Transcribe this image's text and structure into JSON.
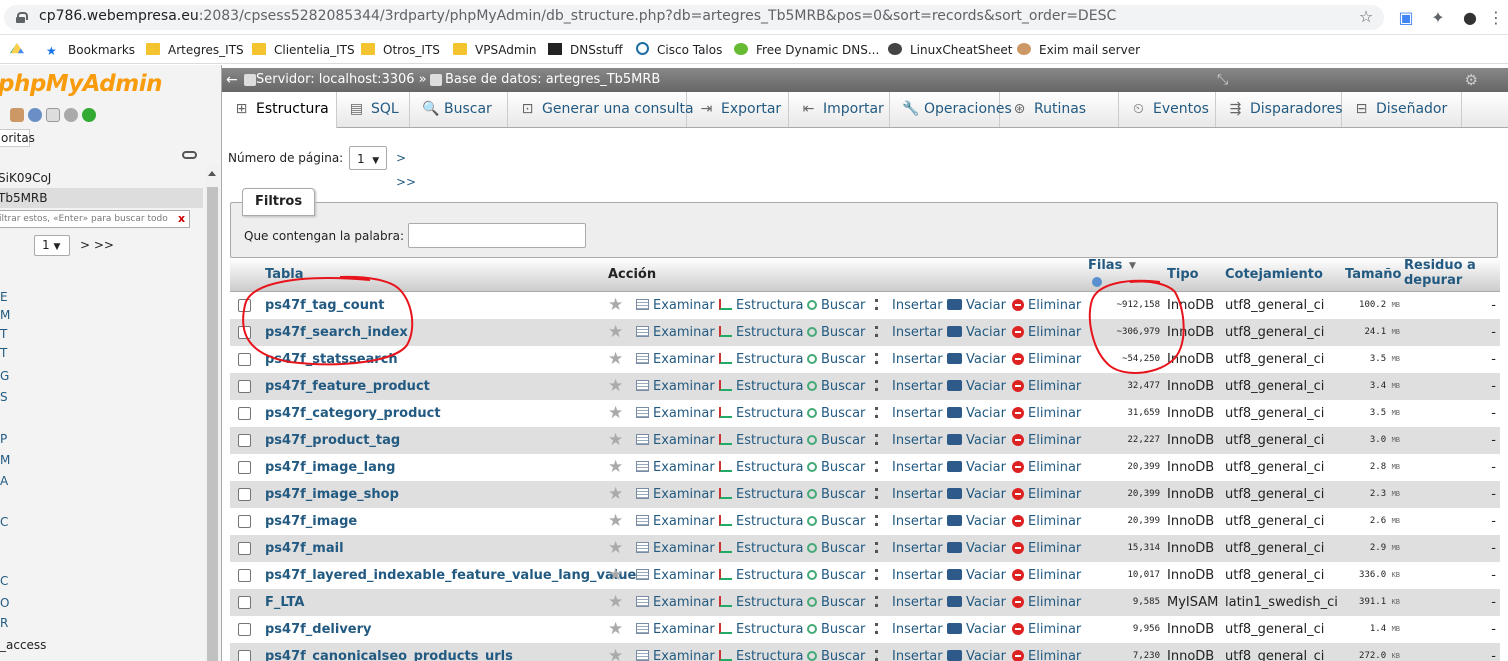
{
  "browser": {
    "url_host": "cp786.webempresa.eu",
    "url_rest": ":2083/cpsess5282085344/3rdparty/phpMyAdmin/db_structure.php?db=artegres_Tb5MRB&pos=0&sort=records&sort_order=DESC",
    "bookmarks": [
      "Bookmarks",
      "Artegres_ITS",
      "Clientelia_ITS",
      "Otros_ITS",
      "VPSAdmin",
      "DNSstuff",
      "Cisco Talos",
      "Free Dynamic DNS...",
      "LinuxCheatSheet",
      "Exim mail server"
    ]
  },
  "nav": {
    "logo_a": "p",
    "logo_b": "hpMyAdmin",
    "fav_tab": "oritas",
    "databases": [
      "SiK09CoJ",
      "Tb5MRB"
    ],
    "filter_placeholder": "iltrar estos, «Enter» para buscar todo",
    "page": "1",
    "next": "> >>",
    "table_letters": [
      "E",
      "M",
      "T",
      "T",
      "G",
      "S",
      "P",
      "M",
      "A",
      "C",
      "C",
      "O",
      "R",
      "_access"
    ]
  },
  "topbar": {
    "server": "Servidor: localhost:3306 »",
    "db": "Base de datos: artegres_Tb5MRB"
  },
  "tabs": [
    {
      "label": "Estructura",
      "icon": "structure-icon"
    },
    {
      "label": "SQL",
      "icon": "sql-icon"
    },
    {
      "label": "Buscar",
      "icon": "search-icon"
    },
    {
      "label": "Generar una consulta",
      "icon": "query-icon"
    },
    {
      "label": "Exportar",
      "icon": "export-icon"
    },
    {
      "label": "Importar",
      "icon": "import-icon"
    },
    {
      "label": "Operaciones",
      "icon": "wrench-icon"
    },
    {
      "label": "Rutinas",
      "icon": "routines-icon"
    },
    {
      "label": "Eventos",
      "icon": "clock-icon"
    },
    {
      "label": "Disparadores",
      "icon": "triggers-icon"
    },
    {
      "label": "Diseñador",
      "icon": "designer-icon"
    }
  ],
  "pagination": {
    "label": "Número de página:",
    "value": "1",
    "next": "> >>"
  },
  "filters": {
    "legend": "Filtros",
    "label": "Que contengan la palabra:",
    "value": ""
  },
  "table": {
    "headers": {
      "tabla": "Tabla",
      "accion": "Acción",
      "filas": "Filas",
      "tipo": "Tipo",
      "cotejamiento": "Cotejamiento",
      "tamano": "Tamaño",
      "residuo": "Residuo a depurar"
    },
    "actions": [
      "Examinar",
      "Estructura",
      "Buscar",
      "Insertar",
      "Vaciar",
      "Eliminar"
    ],
    "rows": [
      {
        "name": "ps47f_tag_count",
        "rows": "~912,158",
        "engine": "InnoDB",
        "collation": "utf8_general_ci",
        "size": "100.2",
        "unit": "MB",
        "overhead": "-"
      },
      {
        "name": "ps47f_search_index",
        "rows": "~306,979",
        "engine": "InnoDB",
        "collation": "utf8_general_ci",
        "size": "24.1",
        "unit": "MB",
        "overhead": "-"
      },
      {
        "name": "ps47f_statssearch",
        "rows": "~54,250",
        "engine": "InnoDB",
        "collation": "utf8_general_ci",
        "size": "3.5",
        "unit": "MB",
        "overhead": "-"
      },
      {
        "name": "ps47f_feature_product",
        "rows": "32,477",
        "engine": "InnoDB",
        "collation": "utf8_general_ci",
        "size": "3.4",
        "unit": "MB",
        "overhead": "-"
      },
      {
        "name": "ps47f_category_product",
        "rows": "31,659",
        "engine": "InnoDB",
        "collation": "utf8_general_ci",
        "size": "3.5",
        "unit": "MB",
        "overhead": "-"
      },
      {
        "name": "ps47f_product_tag",
        "rows": "22,227",
        "engine": "InnoDB",
        "collation": "utf8_general_ci",
        "size": "3.0",
        "unit": "MB",
        "overhead": "-"
      },
      {
        "name": "ps47f_image_lang",
        "rows": "20,399",
        "engine": "InnoDB",
        "collation": "utf8_general_ci",
        "size": "2.8",
        "unit": "MB",
        "overhead": "-"
      },
      {
        "name": "ps47f_image_shop",
        "rows": "20,399",
        "engine": "InnoDB",
        "collation": "utf8_general_ci",
        "size": "2.3",
        "unit": "MB",
        "overhead": "-"
      },
      {
        "name": "ps47f_image",
        "rows": "20,399",
        "engine": "InnoDB",
        "collation": "utf8_general_ci",
        "size": "2.6",
        "unit": "MB",
        "overhead": "-"
      },
      {
        "name": "ps47f_mail",
        "rows": "15,314",
        "engine": "InnoDB",
        "collation": "utf8_general_ci",
        "size": "2.9",
        "unit": "MB",
        "overhead": "-"
      },
      {
        "name": "ps47f_layered_indexable_feature_value_lang_value",
        "rows": "10,017",
        "engine": "InnoDB",
        "collation": "utf8_general_ci",
        "size": "336.0",
        "unit": "KB",
        "overhead": "-"
      },
      {
        "name": "F_LTA",
        "rows": "9,585",
        "engine": "MyISAM",
        "collation": "latin1_swedish_ci",
        "size": "391.1",
        "unit": "KB",
        "overhead": "-"
      },
      {
        "name": "ps47f_delivery",
        "rows": "9,956",
        "engine": "InnoDB",
        "collation": "utf8_general_ci",
        "size": "1.4",
        "unit": "MB",
        "overhead": "-"
      },
      {
        "name": "ps47f_canonicalseo_products_urls",
        "rows": "7,230",
        "engine": "InnoDB",
        "collation": "utf8_general_ci",
        "size": "272.0",
        "unit": "KB",
        "overhead": "-"
      }
    ]
  },
  "colors": {
    "link": "#235a81",
    "annotation": "#e8141b",
    "orange": "#f89c0e",
    "logo_blue": "#6c78af"
  }
}
